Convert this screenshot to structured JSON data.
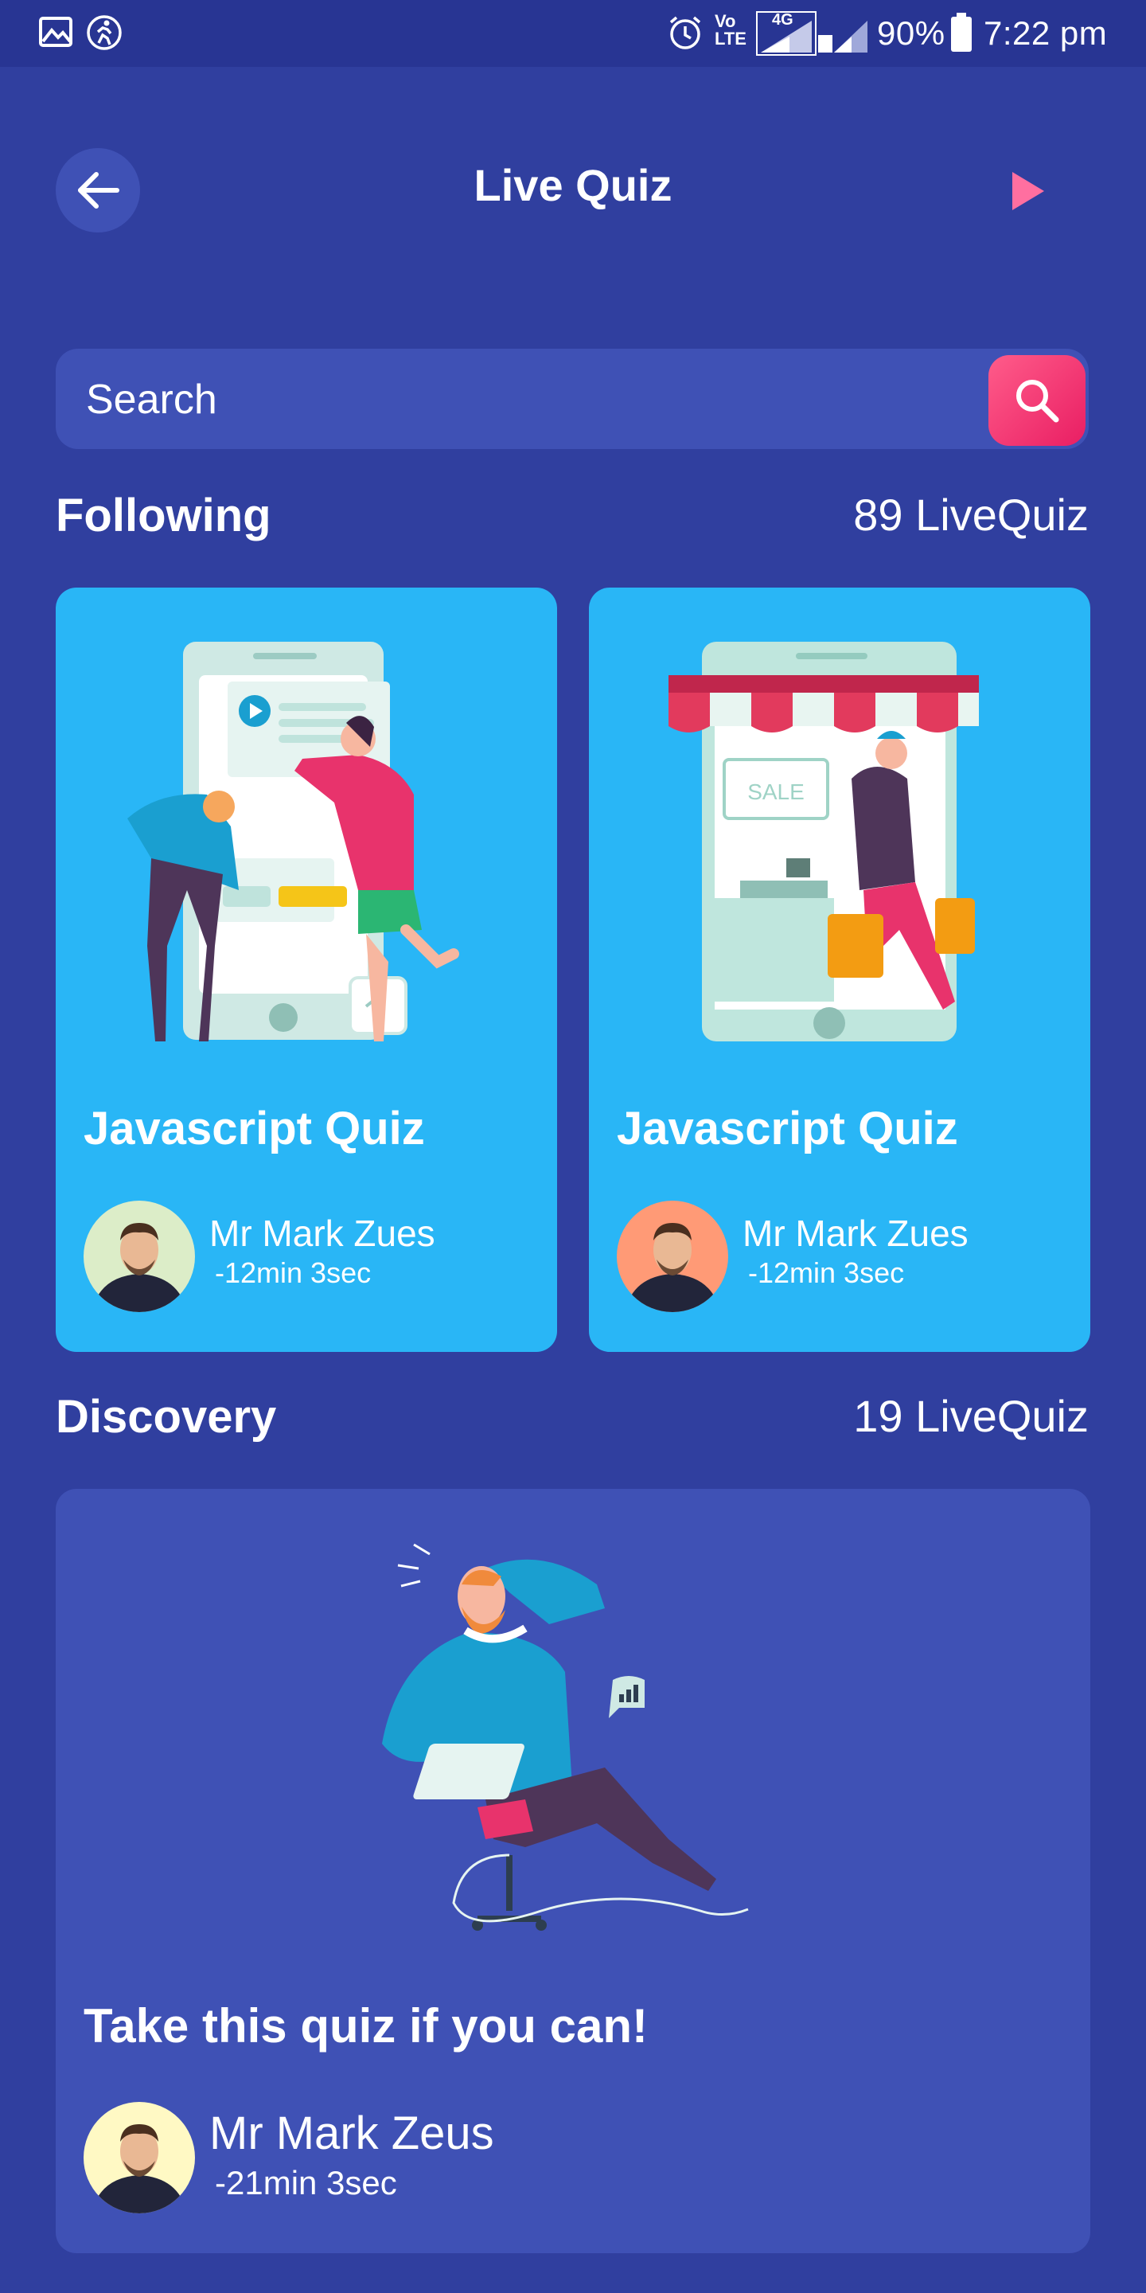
{
  "status_bar": {
    "network": "Vo\nLTE",
    "signal_label": "4G",
    "battery": "90%",
    "time": "7:22 pm"
  },
  "header": {
    "title": "Live Quiz"
  },
  "search": {
    "placeholder": "Search"
  },
  "following": {
    "title": "Following",
    "count": "89 LiveQuiz",
    "cards": [
      {
        "title": "Javascript Quiz",
        "author": "Mr Mark Zues",
        "time": "-12min 3sec",
        "avatar_bg": "#dcedc8"
      },
      {
        "title": "Javascript Quiz",
        "author": "Mr Mark Zues",
        "time": "-12min 3sec",
        "avatar_bg": "#ff9a76"
      }
    ]
  },
  "discovery": {
    "title": "Discovery",
    "count": "19 LiveQuiz",
    "card": {
      "title": "Take this quiz if you can!",
      "author": "Mr Mark Zeus",
      "time": "-21min 3sec",
      "avatar_bg": "#fff9c4"
    }
  },
  "colors": {
    "background": "#303f9f",
    "card_blue": "#29b6f6",
    "card_indigo": "#3f51b5",
    "accent_pink": "#e91e63"
  },
  "icons": [
    "image-icon",
    "run-icon",
    "alarm-icon",
    "battery-icon",
    "back-arrow-icon",
    "play-icon",
    "search-icon"
  ]
}
